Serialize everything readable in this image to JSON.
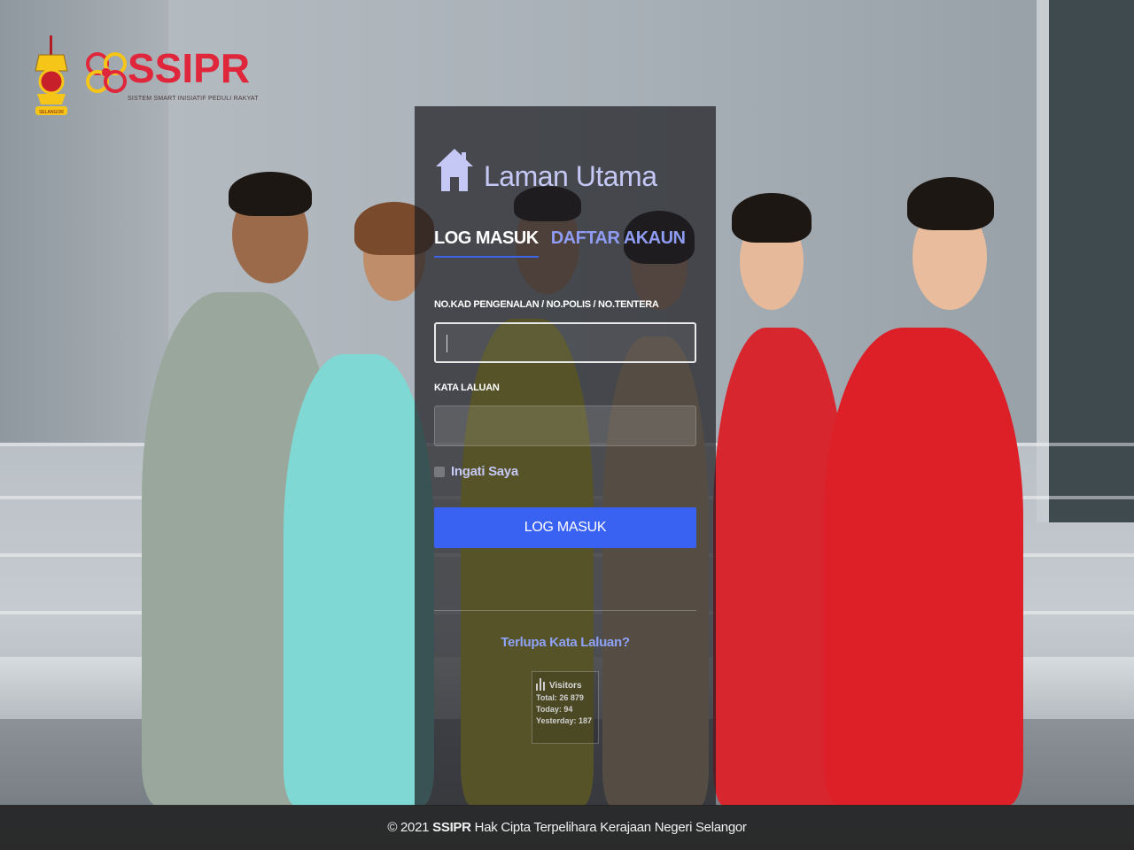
{
  "brand": {
    "name": "SSIPR",
    "tagline": "SISTEM SMART INISIATIF PEDULI RAKYAT",
    "crest_label": "SELANGOR",
    "colors": {
      "primary": "#e0263a",
      "accent": "#f5c518"
    }
  },
  "panel": {
    "title": "Laman Utama",
    "icon": "home-icon",
    "tabs": [
      {
        "label": "LOG MASUK",
        "active": true
      },
      {
        "label": "DAFTAR AKAUN",
        "active": false
      }
    ],
    "fields": {
      "ic_label": "NO.KAD PENGENALAN / NO.POLIS / NO.TENTERA",
      "ic_value": "",
      "password_label": "KATA LALUAN",
      "password_value": ""
    },
    "remember_label": "Ingati Saya",
    "login_button": "LOG MASUK",
    "forgot_link": "Terlupa Kata Laluan?",
    "visitors": {
      "title": "Visitors",
      "total": "Total: 26 879",
      "today": "Today: 94",
      "yesterday": "Yesterday: 187"
    },
    "colors": {
      "button": "#3a62f2",
      "title": "#c5c8f5",
      "link": "#8fa2f5"
    }
  },
  "footer": {
    "prefix": "© 2021",
    "brand": "SSIPR",
    "text": "Hak Cipta Terpelihara Kerajaan Negeri Selangor"
  }
}
